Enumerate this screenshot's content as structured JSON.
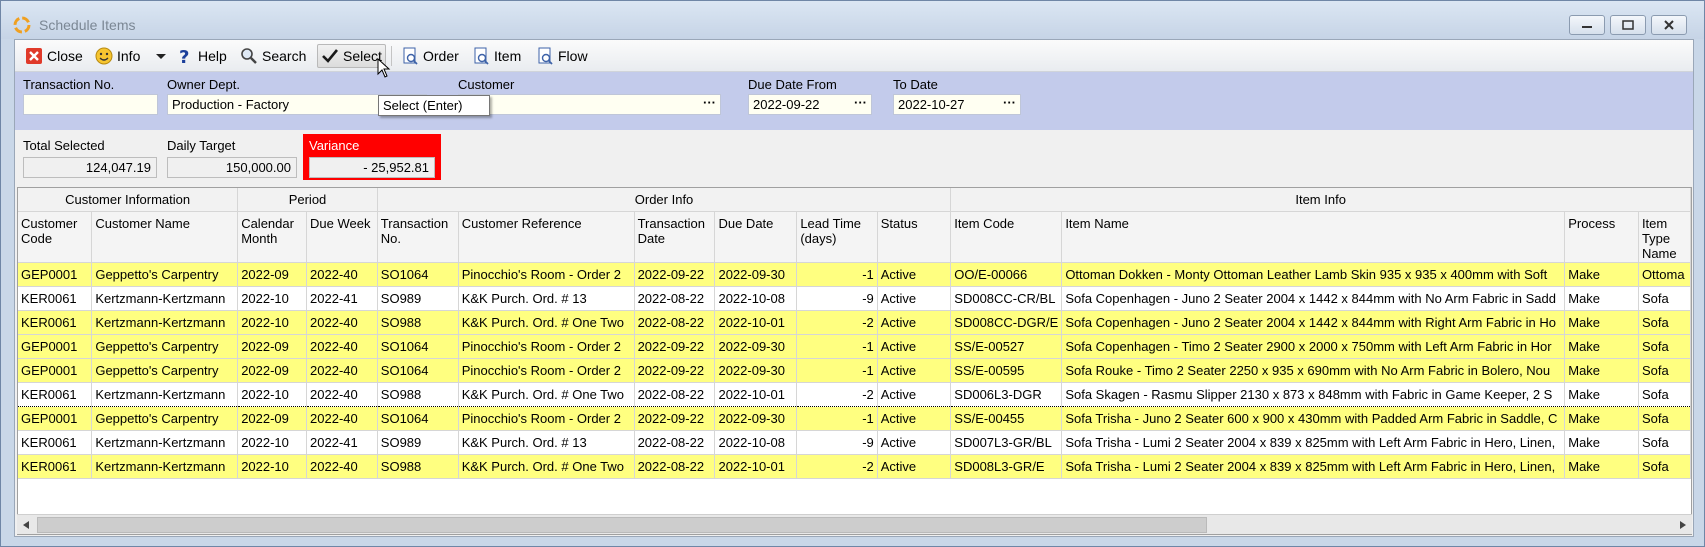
{
  "window": {
    "title": "Schedule Items"
  },
  "toolbar": {
    "close": "Close",
    "info": "Info",
    "help": "Help",
    "search": "Search",
    "select": "Select",
    "order": "Order",
    "item": "Item",
    "flow": "Flow"
  },
  "tooltip": "Select (Enter)",
  "filters": {
    "transaction_no": {
      "label": "Transaction No.",
      "value": ""
    },
    "owner_dept": {
      "label": "Owner Dept.",
      "value": "Production - Factory"
    },
    "customer": {
      "label": "Customer",
      "value": ""
    },
    "due_from": {
      "label": "Due Date From",
      "value": "2022-09-22"
    },
    "to_date": {
      "label": "To Date",
      "value": "2022-10-27"
    },
    "ellipsis": "···"
  },
  "summary": {
    "total_selected": {
      "label": "Total Selected",
      "value": "124,047.19"
    },
    "daily_target": {
      "label": "Daily Target",
      "value": "150,000.00"
    },
    "variance": {
      "label": "Variance",
      "value": "- 25,952.81"
    }
  },
  "colors": {
    "highlight": "#ffff80",
    "variance": "#ff0000",
    "filter_bg": "#c3cbeb"
  },
  "grid": {
    "groups": [
      "Customer Information",
      "Period",
      "Order Info",
      "Item Info"
    ],
    "columns": [
      "Customer\nCode",
      "Customer Name",
      "Calendar\nMonth",
      "Due Week",
      "Transaction\nNo.",
      "Customer Reference",
      "Transaction\nDate",
      "Due Date",
      "Lead Time\n(days)",
      "Status",
      "Item Code",
      "Item Name",
      "Process",
      "Item\nType\nName"
    ],
    "rows": [
      [
        "GEP0001",
        "Geppetto's Carpentry",
        "2022-09",
        "2022-40",
        "SO1064",
        "Pinocchio's Room - Order 2",
        "2022-09-22",
        "2022-09-30",
        "-1",
        "Active",
        "OO/E-00066",
        "Ottoman Dokken - Monty Ottoman Leather Lamb Skin 935 x 935 x 400mm with Soft",
        "Make",
        "Ottoma"
      ],
      [
        "KER0061",
        "Kertzmann-Kertzmann",
        "2022-10",
        "2022-41",
        "SO989",
        "K&K Purch. Ord. # 13",
        "2022-08-22",
        "2022-10-08",
        "-9",
        "Active",
        "SD008CC-CR/BL",
        "Sofa Copenhagen - Juno 2 Seater 2004 x 1442 x 844mm with No Arm Fabric in Sadd",
        "Make",
        "Sofa"
      ],
      [
        "KER0061",
        "Kertzmann-Kertzmann",
        "2022-10",
        "2022-40",
        "SO988",
        "K&K Purch. Ord. # One Two",
        "2022-08-22",
        "2022-10-01",
        "-2",
        "Active",
        "SD008CC-DGR/E",
        "Sofa Copenhagen - Juno 2 Seater 2004 x 1442 x 844mm with Right Arm Fabric in Ho",
        "Make",
        "Sofa"
      ],
      [
        "GEP0001",
        "Geppetto's Carpentry",
        "2022-09",
        "2022-40",
        "SO1064",
        "Pinocchio's Room - Order 2",
        "2022-09-22",
        "2022-09-30",
        "-1",
        "Active",
        "SS/E-00527",
        "Sofa Copenhagen - Timo 2 Seater 2900 x 2000 x 750mm with Left Arm Fabric in Hor",
        "Make",
        "Sofa"
      ],
      [
        "GEP0001",
        "Geppetto's Carpentry",
        "2022-09",
        "2022-40",
        "SO1064",
        "Pinocchio's Room - Order 2",
        "2022-09-22",
        "2022-09-30",
        "-1",
        "Active",
        "SS/E-00595",
        "Sofa Rouke - Timo 2 Seater 2250 x 935 x 690mm with No Arm Fabric in Bolero, Nou",
        "Make",
        "Sofa"
      ],
      [
        "KER0061",
        "Kertzmann-Kertzmann",
        "2022-10",
        "2022-40",
        "SO988",
        "K&K Purch. Ord. # One Two",
        "2022-08-22",
        "2022-10-01",
        "-2",
        "Active",
        "SD006L3-DGR",
        "Sofa Skagen - Rasmu Slipper 2130 x 873 x 848mm with  Fabric in Game Keeper, 2 S",
        "Make",
        "Sofa"
      ],
      [
        "GEP0001",
        "Geppetto's Carpentry",
        "2022-09",
        "2022-40",
        "SO1064",
        "Pinocchio's Room - Order 2",
        "2022-09-22",
        "2022-09-30",
        "-1",
        "Active",
        "SS/E-00455",
        "Sofa Trisha - Juno 2 Seater 600 x 900 x 430mm with Padded Arm Fabric in Saddle, C",
        "Make",
        "Sofa"
      ],
      [
        "KER0061",
        "Kertzmann-Kertzmann",
        "2022-10",
        "2022-41",
        "SO989",
        "K&K Purch. Ord. # 13",
        "2022-08-22",
        "2022-10-08",
        "-9",
        "Active",
        "SD007L3-GR/BL",
        "Sofa Trisha - Lumi 2 Seater 2004 x 839 x 825mm with Left Arm Fabric in Hero, Linen,",
        "Make",
        "Sofa"
      ],
      [
        "KER0061",
        "Kertzmann-Kertzmann",
        "2022-10",
        "2022-40",
        "SO988",
        "K&K Purch. Ord. # One Two",
        "2022-08-22",
        "2022-10-01",
        "-2",
        "Active",
        "SD008L3-GR/E",
        "Sofa Trisha - Lumi 2 Seater 2004 x 839 x 825mm with Left Arm Fabric in Hero, Linen,",
        "Make",
        "Sofa"
      ]
    ],
    "row_highlight": [
      true,
      false,
      true,
      true,
      true,
      false,
      true,
      false,
      true
    ],
    "selected_row": 5
  }
}
